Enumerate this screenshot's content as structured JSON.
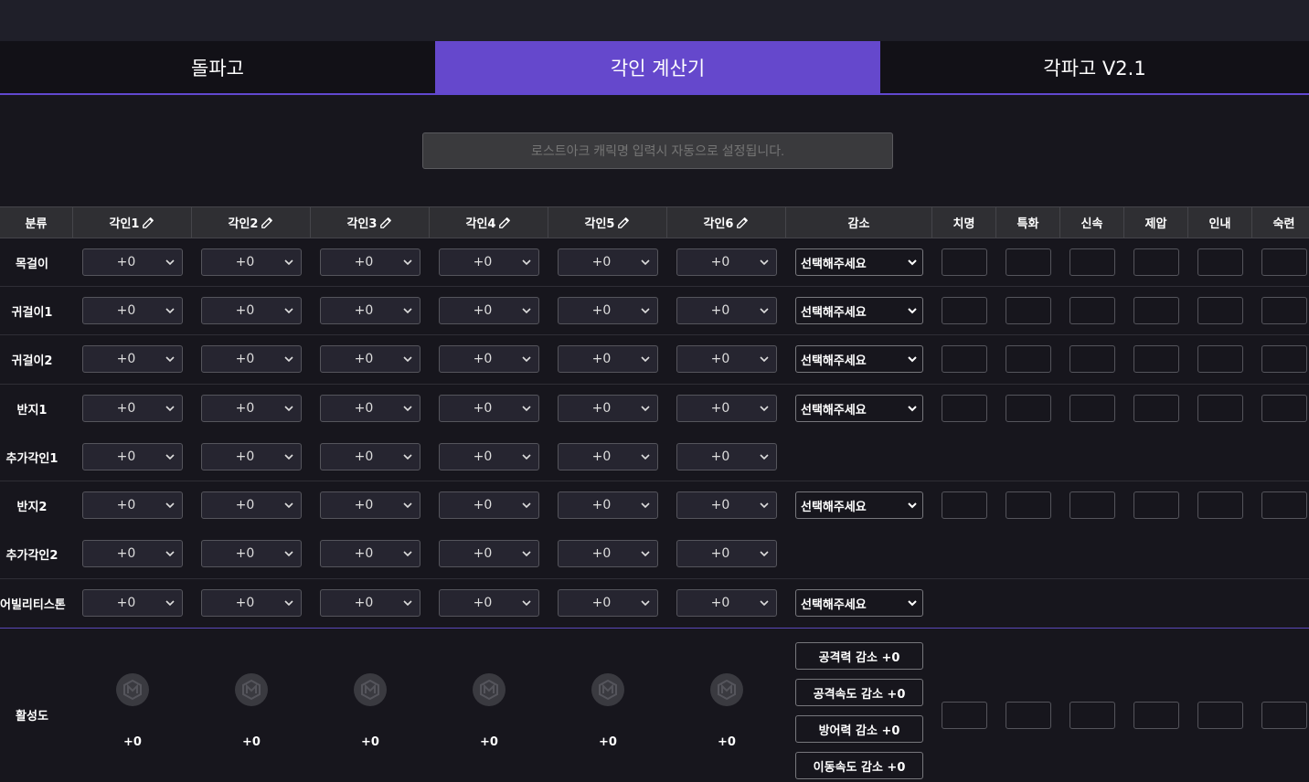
{
  "tabs": [
    {
      "label": "돌파고"
    },
    {
      "label": "각인 계산기"
    },
    {
      "label": "각파고 V2.1"
    }
  ],
  "search": {
    "placeholder": "로스트아크 캐릭명 입력시 자동으로 설정됩니다."
  },
  "headers": [
    "분류",
    "각인1",
    "각인2",
    "각인3",
    "각인4",
    "각인5",
    "각인6",
    "감소",
    "치명",
    "특화",
    "신속",
    "제압",
    "인내",
    "숙련"
  ],
  "engrave_value": "+0",
  "reduce_placeholder": "선택해주세요",
  "rows": [
    {
      "label": "목걸이"
    },
    {
      "label": "귀걸이1"
    },
    {
      "label": "귀걸이2"
    },
    {
      "label": "반지1"
    },
    {
      "label": "추가각인1"
    },
    {
      "label": "반지2"
    },
    {
      "label": "추가각인2"
    },
    {
      "label": "어빌리티스톤"
    }
  ],
  "activation": {
    "label": "활성도",
    "values": [
      "+0",
      "+0",
      "+0",
      "+0",
      "+0",
      "+0"
    ],
    "penalties": [
      "공격력 감소 +0",
      "공격속도 감소 +0",
      "방어력 감소 +0",
      "이동속도 감소 +0"
    ]
  },
  "icons": {
    "pencil": "pencil-icon",
    "chevron": "chevron-down-icon",
    "gem": "gem-icon"
  },
  "colors": {
    "accent": "#6548cc",
    "background": "#17161d"
  }
}
